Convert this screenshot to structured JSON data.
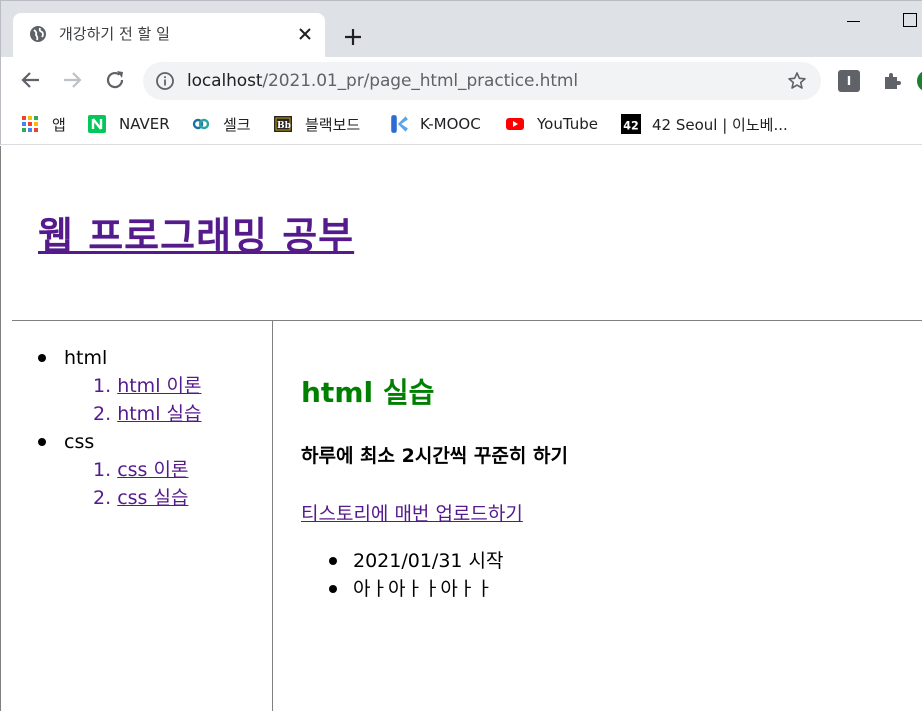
{
  "browser": {
    "tab_title": "개강하기 전 할 일",
    "url_host": "localhost",
    "url_path": "/2021.01_pr/page_html_practice.html",
    "extension_label": "I",
    "bookmarks": [
      {
        "label": "앱",
        "icon": "apps-grid-icon"
      },
      {
        "label": "NAVER",
        "icon": "naver-icon"
      },
      {
        "label": "셀크",
        "icon": "selc-icon"
      },
      {
        "label": "블랙보드",
        "icon": "blackboard-icon"
      },
      {
        "label": "K-MOOC",
        "icon": "kmooc-icon"
      },
      {
        "label": "YouTube",
        "icon": "youtube-icon"
      },
      {
        "label": "42 Seoul | 이노베...",
        "icon": "42-seoul-icon"
      }
    ]
  },
  "page": {
    "title": "웹 프로그래밍 공부",
    "sidebar": {
      "sections": [
        {
          "label": "html",
          "items": [
            {
              "num": "1.",
              "label": "html 이론"
            },
            {
              "num": "2.",
              "label": "html 실습"
            }
          ]
        },
        {
          "label": "css",
          "items": [
            {
              "num": "1.",
              "label": "css 이론"
            },
            {
              "num": "2.",
              "label": "css 실습"
            }
          ]
        }
      ]
    },
    "main": {
      "heading": "html 실습",
      "subheading": "하루에 최소 2시간씩 꾸준히 하기",
      "link": "티스토리에 매번 업로드하기",
      "list": [
        "2021/01/31 시작",
        "아ㅏ아ㅏㅏ아ㅏㅏ"
      ]
    }
  },
  "colors": {
    "visited_link": "#551a8b",
    "heading_green": "#008000",
    "chrome_bg": "#dee1e6"
  }
}
